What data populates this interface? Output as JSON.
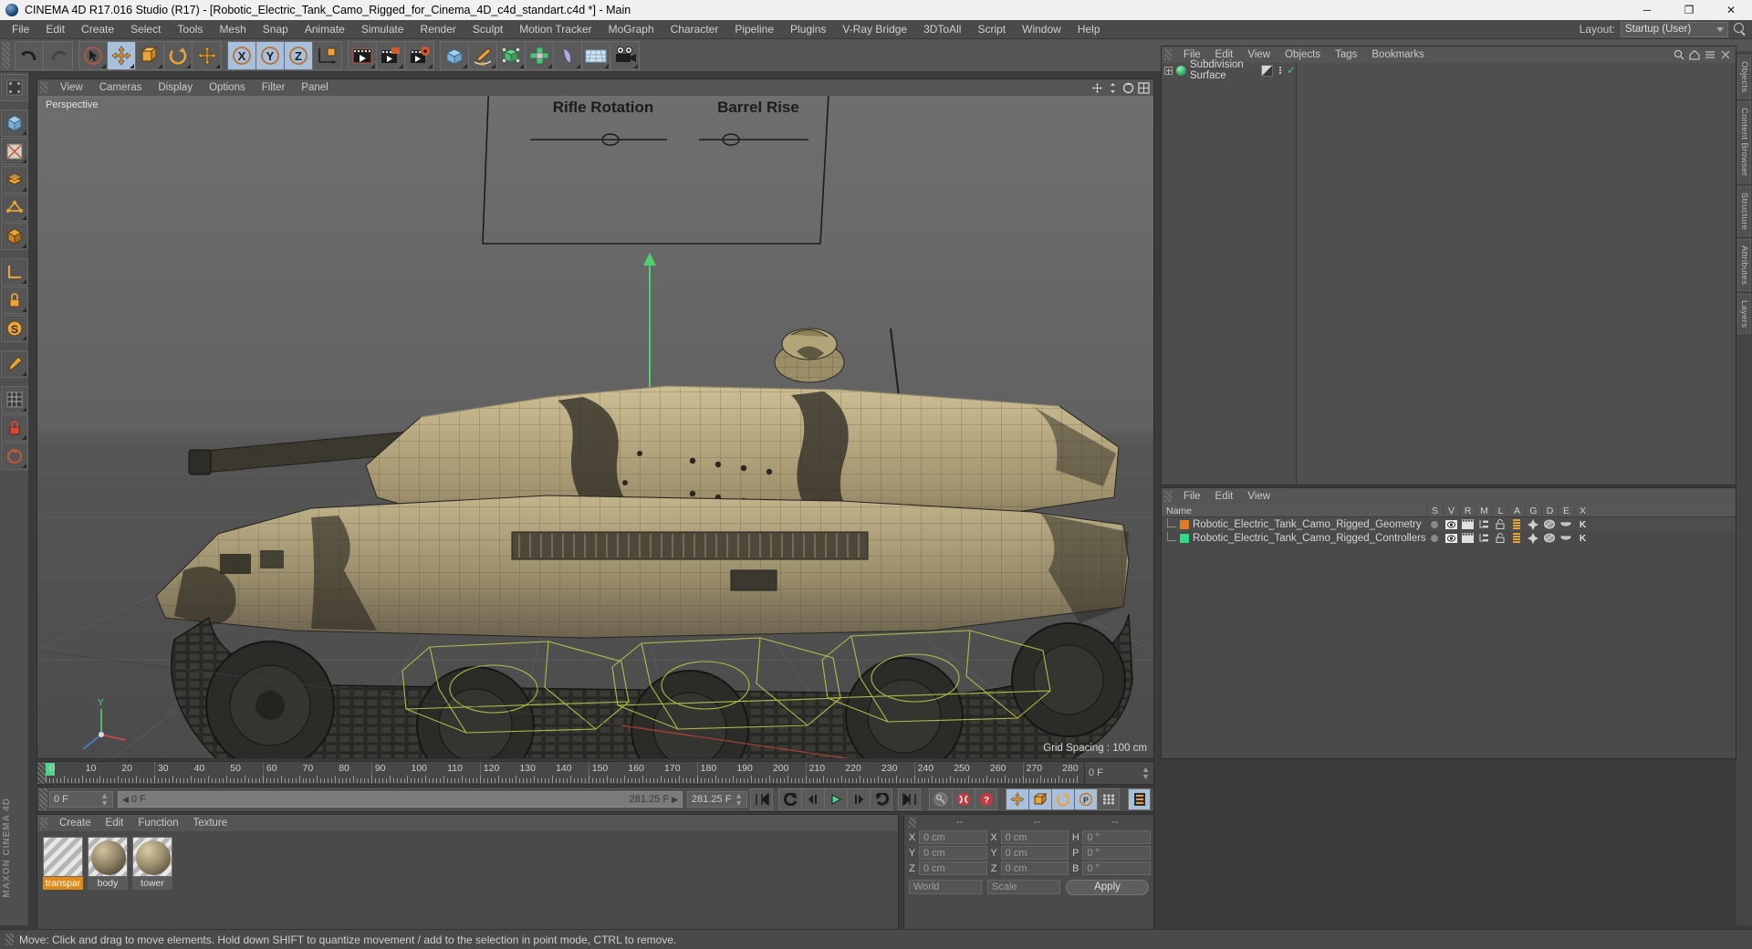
{
  "window": {
    "title": "CINEMA 4D R17.016 Studio (R17) - [Robotic_Electric_Tank_Camo_Rigged_for_Cinema_4D_c4d_standart.c4d *] - Main",
    "minimize": "─",
    "maximize": "❐",
    "close": "✕"
  },
  "menubar": {
    "items": [
      "File",
      "Edit",
      "Create",
      "Select",
      "Tools",
      "Mesh",
      "Snap",
      "Animate",
      "Simulate",
      "Render",
      "Sculpt",
      "Motion Tracker",
      "MoGraph",
      "Character",
      "Pipeline",
      "Plugins",
      "V-Ray Bridge",
      "3DToAll",
      "Script",
      "Window",
      "Help"
    ],
    "layout_label": "Layout:",
    "layout_value": "Startup (User)"
  },
  "viewport": {
    "menu": [
      "View",
      "Cameras",
      "Display",
      "Options",
      "Filter",
      "Panel"
    ],
    "label": "Perspective",
    "grid_spacing": "Grid Spacing : 100 cm",
    "hud_top_left": "Rifle Rotation",
    "hud_top_right": "Barrel Rise"
  },
  "object_manager": {
    "menu": [
      "File",
      "Edit",
      "View",
      "Objects",
      "Tags",
      "Bookmarks"
    ],
    "rows": [
      {
        "name": "Subdivision Surface"
      }
    ]
  },
  "layer_manager": {
    "menu": [
      "File",
      "Edit",
      "View"
    ],
    "columns": [
      "Name",
      "S",
      "V",
      "R",
      "M",
      "L",
      "A",
      "G",
      "D",
      "E",
      "X"
    ],
    "rows": [
      {
        "name": "Robotic_Electric_Tank_Camo_Rigged_Geometry",
        "color": "#e07b2a"
      },
      {
        "name": "Robotic_Electric_Tank_Camo_Rigged_Controllers",
        "color": "#2fd98a"
      }
    ]
  },
  "timeline": {
    "ticks": [
      "0",
      "10",
      "20",
      "30",
      "40",
      "50",
      "60",
      "70",
      "80",
      "90",
      "100",
      "110",
      "120",
      "130",
      "140",
      "150",
      "160",
      "170",
      "180",
      "190",
      "200",
      "210",
      "220",
      "230",
      "240",
      "250",
      "260",
      "270",
      "280"
    ],
    "current_frame_field": "0 F"
  },
  "playback": {
    "current_frame": "0 F",
    "range_start": "0 F",
    "range_end": "281.25 F",
    "end_field": "281.25 F"
  },
  "material_manager": {
    "menu": [
      "Create",
      "Edit",
      "Function",
      "Texture"
    ],
    "materials": [
      {
        "name": "transpar",
        "selected": true,
        "sphere": "transparent"
      },
      {
        "name": "body",
        "selected": false,
        "sphere": "#8e8264"
      },
      {
        "name": "tower",
        "selected": false,
        "sphere": "#978a6a"
      }
    ]
  },
  "coordinates": {
    "headers": [
      "--",
      "--",
      "--"
    ],
    "position": {
      "x_label": "X",
      "x": "0 cm",
      "y_label": "Y",
      "y": "0 cm",
      "z_label": "Z",
      "z": "0 cm"
    },
    "size": {
      "x_label": "X",
      "x": "0 cm",
      "y_label": "Y",
      "y": "0 cm",
      "z_label": "Z",
      "z": "0 cm"
    },
    "rotation": {
      "h_label": "H",
      "h": "0 °",
      "p_label": "P",
      "p": "0 °",
      "b_label": "B",
      "b": "0 °"
    },
    "space": "World",
    "mode": "Scale",
    "apply": "Apply"
  },
  "right_dock_tabs": [
    "Objects",
    "Content Browser",
    "Structure",
    "Attributes",
    "Layers"
  ],
  "statusbar": {
    "message": "Move: Click and drag to move elements. Hold down SHIFT to quantize movement / add to the selection in point mode, CTRL to remove."
  },
  "brand": "MAXON CINEMA 4D",
  "colors": {
    "accent_orange": "#e8a33d",
    "active_blue": "#a9c0dd",
    "green": "#4fd48a",
    "panel_bg": "#4a4a4a"
  }
}
